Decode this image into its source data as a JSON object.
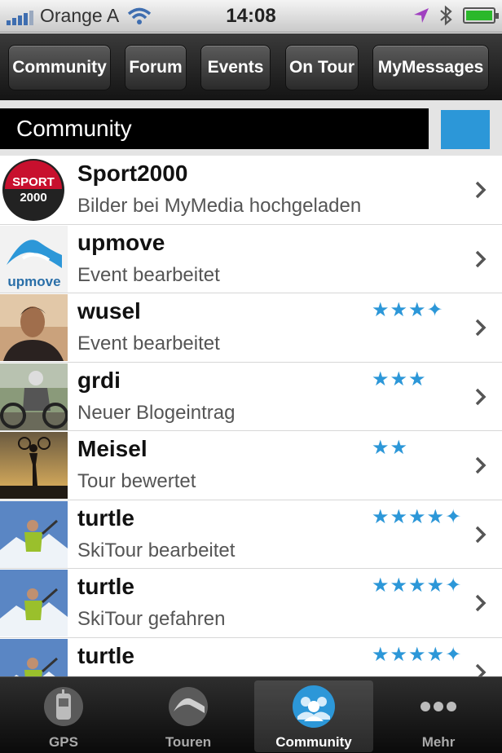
{
  "status_bar": {
    "carrier": "Orange A",
    "time": "14:08"
  },
  "top_tabs": [
    "Community",
    "Forum",
    "Events",
    "On Tour",
    "MyMessages"
  ],
  "section": {
    "title": "Community"
  },
  "feed": [
    {
      "name": "Sport2000",
      "activity": "Bilder bei MyMedia hochgeladen",
      "rating": "",
      "avatar": "sport2000-logo",
      "logo_text": [
        "SPORT",
        "2000"
      ]
    },
    {
      "name": "upmove",
      "activity": "Event bearbeitet",
      "rating": "",
      "avatar": "upmove-logo",
      "logo_text": [
        "upmove"
      ]
    },
    {
      "name": "wusel",
      "activity": "Event bearbeitet",
      "rating": "3.5",
      "avatar": "portrait-photo"
    },
    {
      "name": "grdi",
      "activity": "Neuer Blogeintrag",
      "rating": "3",
      "avatar": "mountainbiker-photo"
    },
    {
      "name": "Meisel",
      "activity": "Tour bewertet",
      "rating": "2",
      "avatar": "sunset-bike-photo"
    },
    {
      "name": "turtle",
      "activity": "SkiTour bearbeitet",
      "rating": "4.5",
      "avatar": "ski-summit-photo"
    },
    {
      "name": "turtle",
      "activity": "SkiTour gefahren",
      "rating": "4.5",
      "avatar": "ski-summit-photo"
    },
    {
      "name": "turtle",
      "activity": "",
      "rating": "4.5",
      "avatar": "ski-summit-photo"
    }
  ],
  "bottom_tabs": [
    {
      "label": "GPS",
      "icon": "gps-device-icon",
      "active": false
    },
    {
      "label": "Touren",
      "icon": "tour-route-icon",
      "active": false
    },
    {
      "label": "Community",
      "icon": "community-people-icon",
      "active": true
    },
    {
      "label": "Mehr",
      "icon": "more-dots-icon",
      "active": false
    }
  ],
  "colors": {
    "accent": "#2c97d8",
    "section_bg": "#000000",
    "star": "#2c97d8"
  }
}
